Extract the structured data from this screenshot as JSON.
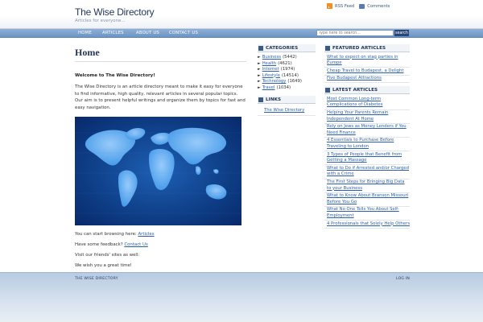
{
  "site": {
    "title": "The Wise Directory",
    "tagline": "Articles for everyone..."
  },
  "feeds": {
    "rss_label": "RSS Feed",
    "comments_label": "Comments"
  },
  "nav": {
    "items": [
      "HOME",
      "ARTICLES",
      "ABOUT US",
      "CONTACT US"
    ]
  },
  "search": {
    "placeholder": "Type here to search...",
    "button_label": "search"
  },
  "main": {
    "page_title": "Home",
    "welcome": "Welcome to The Wise Directory!",
    "intro": "The Wise Directory is an article directory meant to make it easy for everyone to find informative, high quality, relevant articles in several popular topics. Our aim is to present helpful writings and organize them by topics for fast and easy navigation.",
    "browse_prefix": "You can start browsing here: ",
    "browse_link": "Articles",
    "feedback_prefix": "Have some feedback? ",
    "feedback_link": "Contact Us",
    "friends_text": "Visit our friends' sites as well:",
    "wish_text": "We wish you a great time!"
  },
  "categories": {
    "title": "CATEGORIES",
    "items": [
      {
        "name": "Business",
        "count": "(5442)"
      },
      {
        "name": "Health",
        "count": "(4621)"
      },
      {
        "name": "Internet",
        "count": "(1974)"
      },
      {
        "name": "Lifestyle",
        "count": "(14514)"
      },
      {
        "name": "Technology",
        "count": "(1649)"
      },
      {
        "name": "Travel",
        "count": "(1034)"
      }
    ]
  },
  "links": {
    "title": "LINKS",
    "items": [
      "The Wise Directory"
    ]
  },
  "featured": {
    "title": "FEATURED ARTICLES",
    "items": [
      "What to expect on stag parties in Europe",
      "Cheap Travel to Budapest, a Delight",
      "Five Budapest Attractions"
    ]
  },
  "latest": {
    "title": "LATEST ARTICLES",
    "items": [
      "Most Common Long-term Complications of Diabetes",
      "Helping Your Parents Remain Independent At Home",
      "Rely on Jews as Money Lenders if You Need Finance",
      "4 Essentials to Purchase Before Traveling to London",
      "3 Types of People that Benefit from Getting a Massage",
      "What to Do if Arrested and/or Charged with a Crime",
      "The First Steps for Bringing Big Data to your Business",
      "What to Know About Branson Missouri Before You Go",
      "What No One Tells You About Self-Employment",
      "4 Professionals that Solely Help Others"
    ]
  },
  "footer": {
    "left": "THE WISE DIRECTORY",
    "right": "LOG IN"
  },
  "colors": {
    "brand": "#1e3559",
    "nav": "#7aa0cc",
    "link": "#2b5fa9"
  }
}
